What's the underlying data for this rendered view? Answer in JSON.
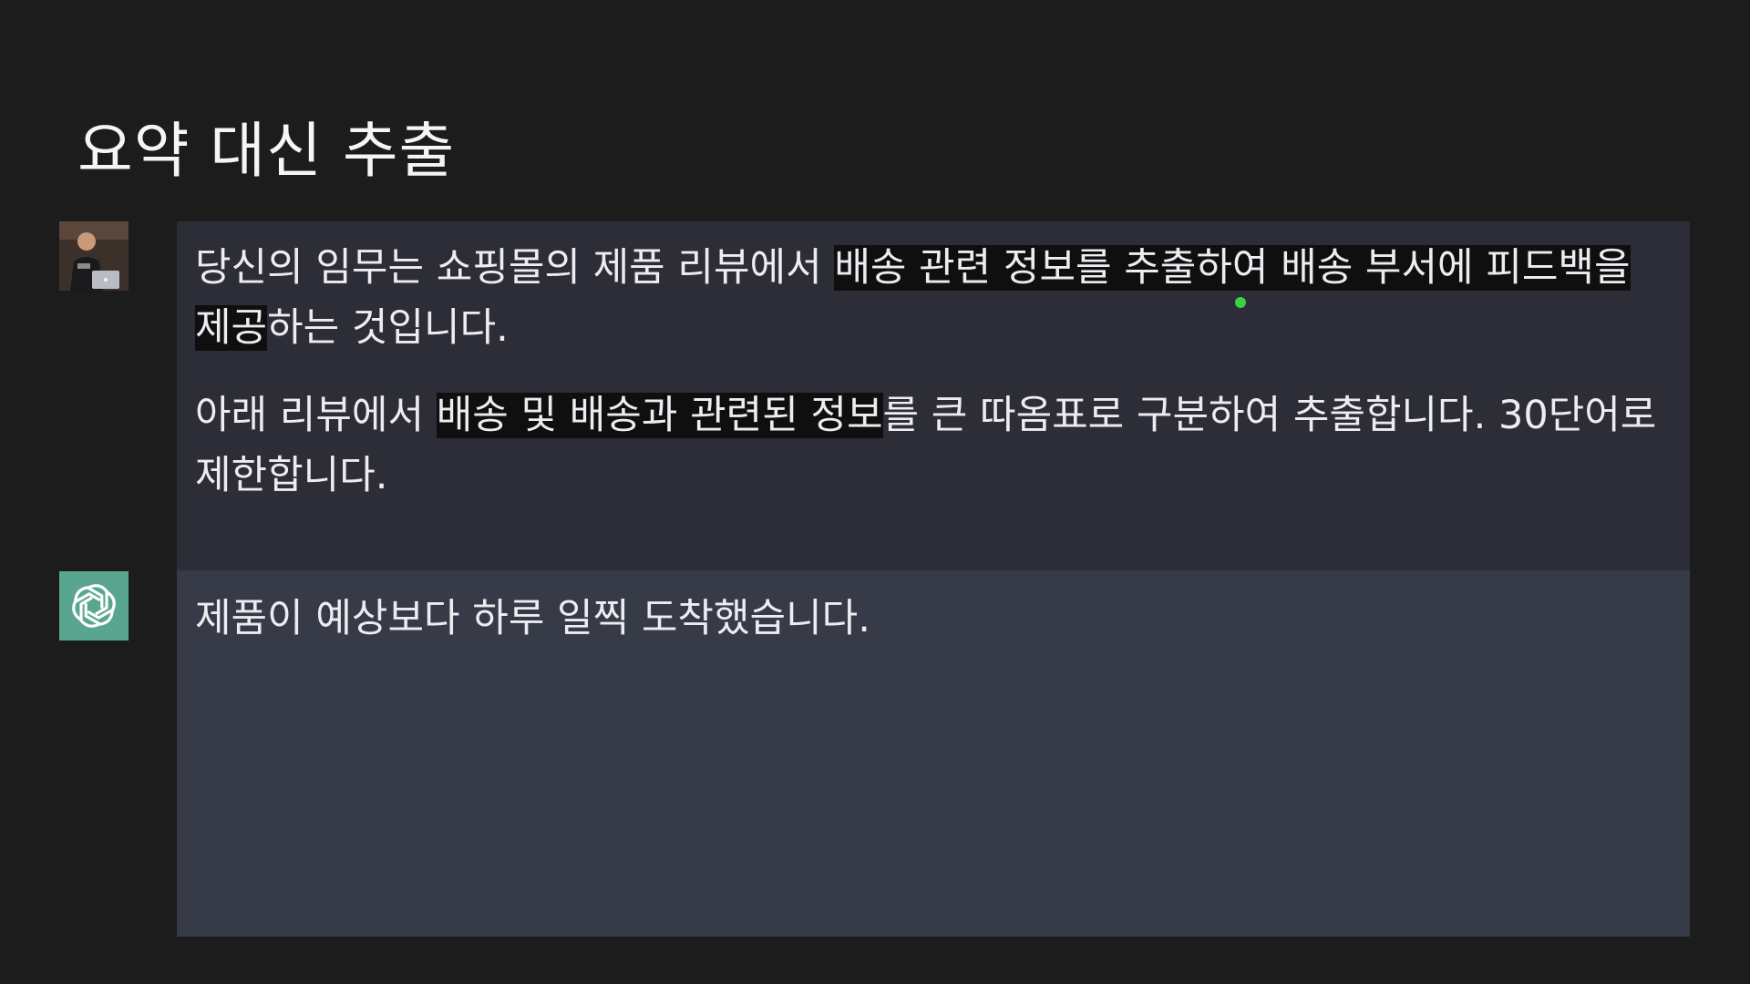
{
  "page_title": "요약 대신 추출",
  "user_message": {
    "avatar_icon": "user-photo-avatar",
    "p1": {
      "plain1": "당신의 임무는 쇼핑몰의 제품 리뷰에서 ",
      "hl1": "배송 관련 정보를 추출하여 배송 부서에 피드백을 제공",
      "plain2": "하는 것입니다."
    },
    "p2": {
      "plain1": "아래 리뷰에서 ",
      "hl1": "배송 및 배송과 관련된 정보",
      "plain2": "를 큰 따옴표로 구분하여 추출합니다. 30단어로 제한합니다."
    }
  },
  "assistant_message": {
    "avatar_icon": "openai-logo-icon",
    "text": "제품이 예상보다 하루 일찍 도착했습니다."
  },
  "colors": {
    "background": "#1c1c1d",
    "user_block": "#2c2d37",
    "assistant_block": "#373a47",
    "assistant_avatar": "#5aa58f",
    "highlight": "#0f0f10",
    "cursor": "#3bd24a"
  }
}
